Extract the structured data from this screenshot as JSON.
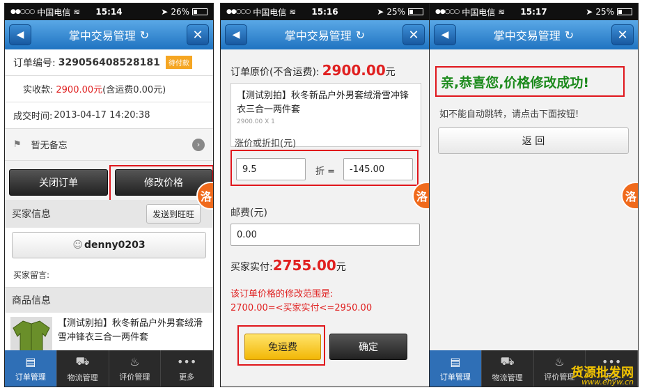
{
  "status": {
    "carrier": "中国电信",
    "screens": [
      {
        "time": "15:14",
        "battery": "26%",
        "level": 0.26
      },
      {
        "time": "15:16",
        "battery": "25%",
        "level": 0.25
      },
      {
        "time": "15:17",
        "battery": "25%",
        "level": 0.25
      }
    ]
  },
  "nav": {
    "title": "掌中交易管理"
  },
  "s1": {
    "order_label": "订单编号:",
    "order_no": "329056408528181",
    "badge": "待付款",
    "paid_label": "实收款:",
    "paid_value": "2900.00元",
    "paid_note": "(含运费0.00元)",
    "time_label": "成交时间:",
    "time_value": "2013-04-17 14:20:38",
    "memo": "暂无备忘",
    "close_btn": "关闭订单",
    "modify_btn": "修改价格",
    "buyer_section": "买家信息",
    "send_btn": "发送到旺旺",
    "buyer_name": "denny0203",
    "buyer_msg": "买家留言:",
    "goods_section": "商品信息",
    "goods_title": "【测试别拍】秋冬新品户外男套绒滑雪冲锋衣三合一两件套"
  },
  "s2": {
    "orig_label": "订单原价(不含运费):",
    "orig_value": "2900.00",
    "orig_unit": "元",
    "item_title": "【测试别拍】秋冬新品户外男套绒滑雪冲锋衣三合一两件套",
    "item_sub": "2900.00 X 1",
    "adjust_label": "涨价或折扣(元)",
    "discount": "9.5",
    "zhe": "折 =",
    "adjust_value": "-145.00",
    "ship_label": "邮费(元)",
    "ship_value": "0.00",
    "pay_label": "买家实付:",
    "pay_value": "2755.00",
    "pay_unit": "元",
    "range_line1": "该订单价格的修改范围是:",
    "range_line2": "2700.00=<买家实付<=2950.00",
    "free_ship_btn": "免运费",
    "confirm_btn": "确定"
  },
  "s3": {
    "success": "亲,恭喜您,价格修改成功!",
    "hint": "如不能自动跳转，请点击下面按钮!",
    "back_btn": "返 回"
  },
  "tabs": [
    "订单管理",
    "物流管理",
    "评价管理",
    "更多"
  ],
  "watermark": {
    "brand": "货源批发网",
    "url": "www.ehyw.cn"
  }
}
